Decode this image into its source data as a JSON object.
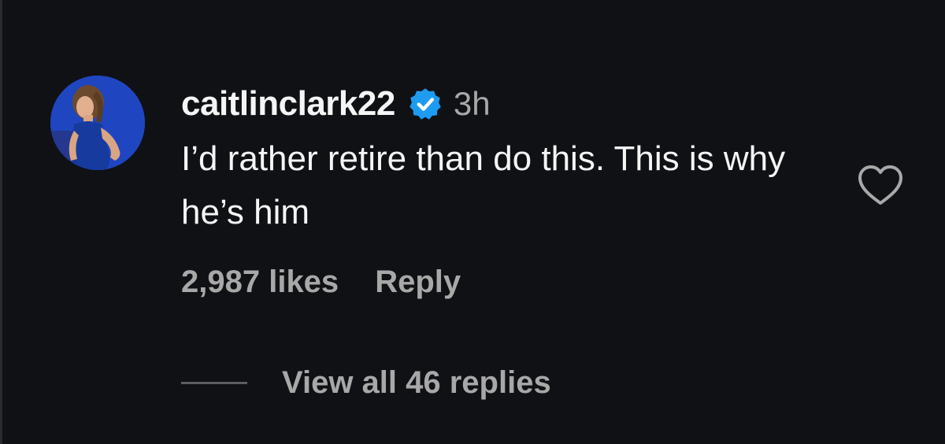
{
  "comment": {
    "username": "caitlinclark22",
    "verified": true,
    "timestamp": "3h",
    "text": "I’d rather retire than do this. This is why he’s him",
    "likes": "2,987 likes",
    "reply_label": "Reply",
    "view_replies_label": "View all 46 replies"
  },
  "icons": {
    "verified": "verified-badge-icon",
    "like": "heart-outline-icon"
  },
  "colors": {
    "background": "#0f1115",
    "primary_text": "#f5f5f5",
    "secondary_text": "#a8a8a8",
    "verified_blue": "#1d9bf0"
  }
}
